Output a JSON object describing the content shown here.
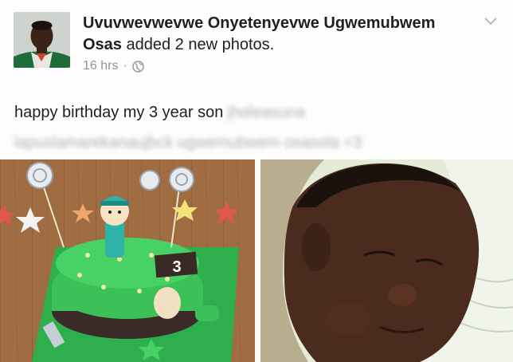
{
  "post": {
    "author": "Uvuvwevwevwe Onyetenyevwe Ugwemubwem Osas",
    "action": "added 2 new photos.",
    "time": "16 hrs",
    "separator": "·",
    "privacy_icon": "globe-icon",
    "menu_icon": "chevron-down-icon",
    "caption_text": "happy birthday my 3 year  son",
    "caption_blurred_line1": "jholeasuna",
    "caption_blurred_line2": "lapuslamarekanaujbck ugwemubwem osasola <3",
    "cake_topper_number": "3"
  },
  "colors": {
    "name_text": "#1d1f23",
    "meta_text": "#90949c",
    "cake_green": "#2fb14c",
    "wood": "#a06c42"
  }
}
